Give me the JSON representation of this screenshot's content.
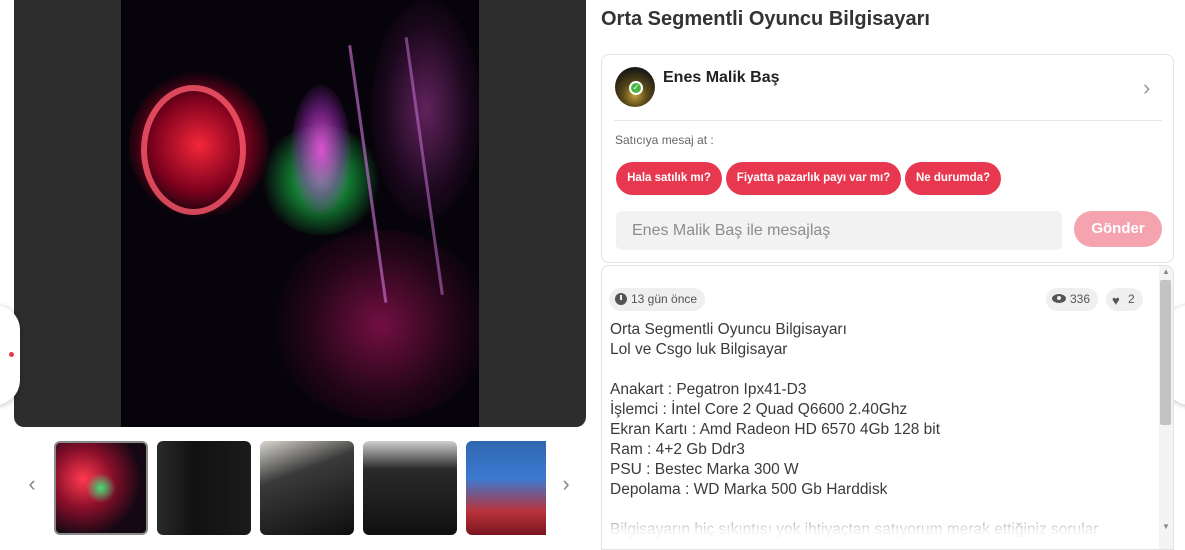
{
  "listing": {
    "title": "Orta Segmentli Oyuncu Bilgisayarı"
  },
  "gallery": {
    "thumbnail_count": 5,
    "active_index": 0,
    "prev_arrow": "‹",
    "next_arrow": "›"
  },
  "seller": {
    "name": "Enes Malik Baş",
    "verified": true,
    "message_label": "Satıcıya mesaj at :",
    "quick_replies": [
      "Hala satılık mı?",
      "Fiyatta pazarlık payı var mı?",
      "Ne durumda?"
    ],
    "message_placeholder": "Enes Malik Baş ile mesajlaş",
    "send_label": "Gönder"
  },
  "stats": {
    "posted": "13 gün önce",
    "views": "336",
    "likes": "2"
  },
  "description": {
    "text": "Orta Segmentli Oyuncu Bilgisayarı\nLol ve Csgo luk Bilgisayar\n\nAnakart : Pegatron Ipx41-D3\nİşlemci : İntel Core 2 Quad Q6600 2.40Ghz\nEkran Kartı : Amd Radeon HD 6570 4Gb 128 bit\nRam : 4+2 Gb Ddr3\nPSU : Bestec Marka 300 W\nDepolama : WD Marka 500 Gb Harddisk\n\nBilgisayarın hiç sıkıntısı yok ihtiyaçtan satıyorum merak ettiğiniz sorular"
  },
  "colors": {
    "accent": "#e8384f",
    "send_disabled": "#f5a3ae"
  },
  "icons": {
    "clock": "clock-icon",
    "eye": "eye-icon",
    "heart": "heart-icon",
    "chevron": "chevron-right-icon"
  }
}
